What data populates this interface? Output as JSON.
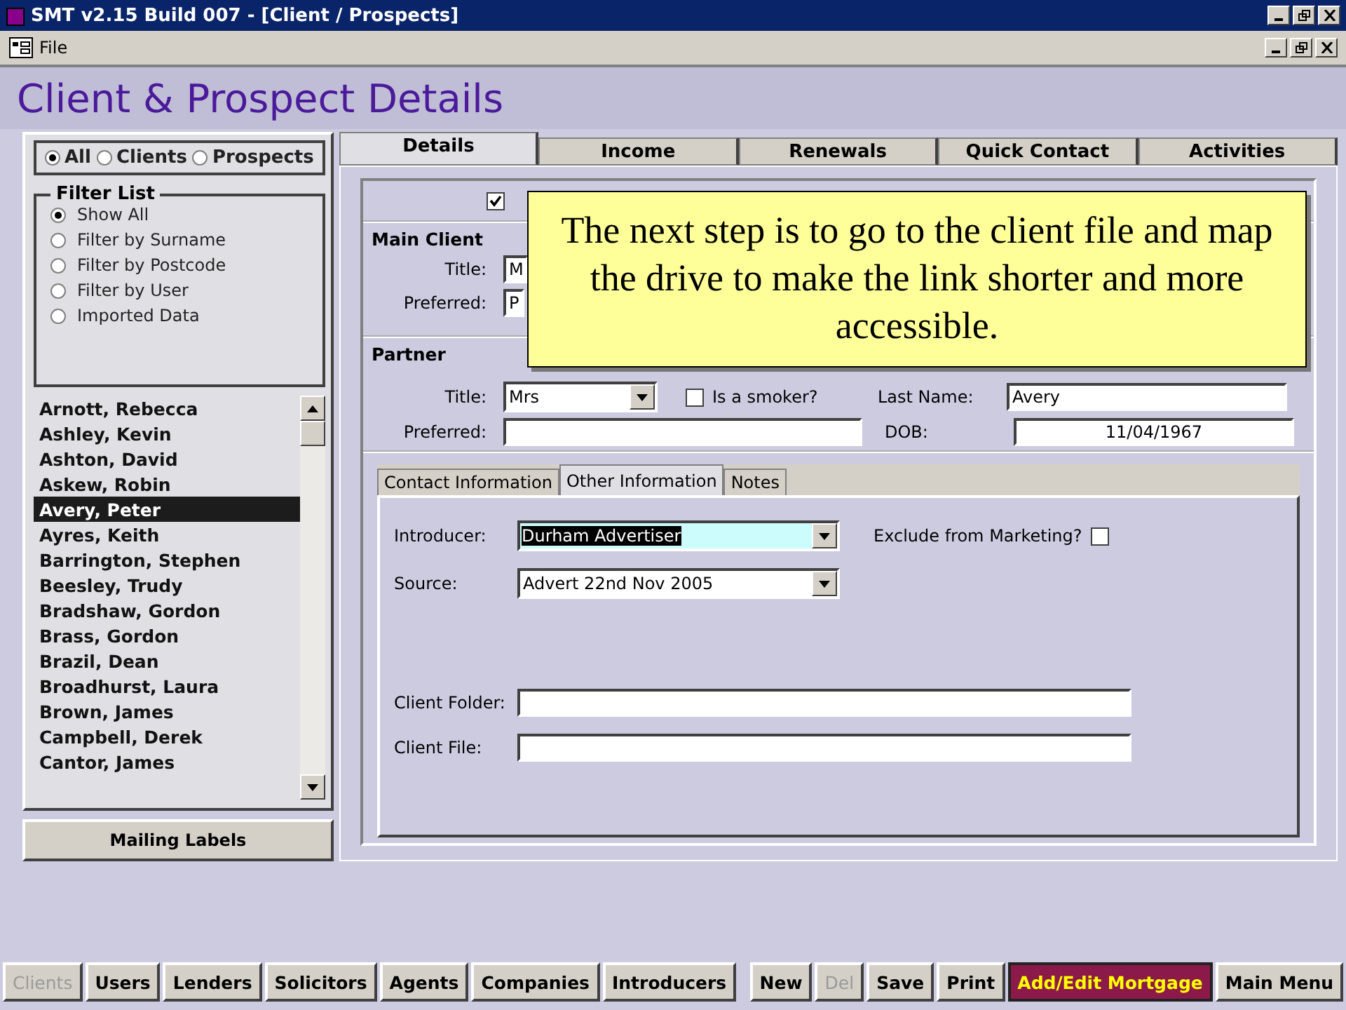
{
  "window": {
    "title": "SMT v2.15 Build 007 - [Client / Prospects]"
  },
  "menu_bar": {
    "items": [
      "File"
    ]
  },
  "header": {
    "title": "Client & Prospect Details"
  },
  "type_filter": [
    {
      "label": "All",
      "selected": true
    },
    {
      "label": "Clients",
      "selected": false
    },
    {
      "label": "Prospects",
      "selected": false
    }
  ],
  "filter_list": {
    "title": "Filter List",
    "options": [
      {
        "label": "Show All",
        "selected": true
      },
      {
        "label": "Filter by Surname",
        "selected": false
      },
      {
        "label": "Filter by Postcode",
        "selected": false
      },
      {
        "label": "Filter by User",
        "selected": false
      },
      {
        "label": "Imported Data",
        "selected": false
      }
    ]
  },
  "client_list": [
    {
      "name": "Arnott, Rebecca",
      "selected": false
    },
    {
      "name": "Ashley, Kevin",
      "selected": false
    },
    {
      "name": "Ashton, David",
      "selected": false
    },
    {
      "name": "Askew, Robin",
      "selected": false
    },
    {
      "name": "Avery, Peter",
      "selected": true
    },
    {
      "name": "Ayres, Keith",
      "selected": false
    },
    {
      "name": "Barrington, Stephen",
      "selected": false
    },
    {
      "name": "Beesley, Trudy",
      "selected": false
    },
    {
      "name": "Bradshaw, Gordon",
      "selected": false
    },
    {
      "name": "Brass, Gordon",
      "selected": false
    },
    {
      "name": "Brazil, Dean",
      "selected": false
    },
    {
      "name": "Broadhurst, Laura",
      "selected": false
    },
    {
      "name": "Brown, James",
      "selected": false
    },
    {
      "name": "Campbell, Derek",
      "selected": false
    },
    {
      "name": "Cantor, James",
      "selected": false
    }
  ],
  "mailing_labels_button": "Mailing Labels",
  "tabs": [
    {
      "label": "Details",
      "selected": true
    },
    {
      "label": "Income",
      "selected": false
    },
    {
      "label": "Renewals",
      "selected": false
    },
    {
      "label": "Quick Contact",
      "selected": false
    },
    {
      "label": "Activities",
      "selected": false
    }
  ],
  "details": {
    "top_checkbox": {
      "checked": true
    },
    "main_client": {
      "heading": "Main Client",
      "title_label": "Title:",
      "title_value": "M",
      "preferred_label": "Preferred:",
      "preferred_value": "P"
    },
    "partner": {
      "heading": "Partner",
      "title_label": "Title:",
      "title_value": "Mrs",
      "smoker_checked": false,
      "smoker_label": "Is a smoker?",
      "last_name_label": "Last Name:",
      "last_name_value": "Avery",
      "preferred_label": "Preferred:",
      "dob_label": "DOB:",
      "dob_value": "11/04/1967"
    }
  },
  "sub_tabs": [
    {
      "label": "Contact Information",
      "selected": false
    },
    {
      "label": "Other Information",
      "selected": true
    },
    {
      "label": "Notes",
      "selected": false
    }
  ],
  "other_information": {
    "introducer_label": "Introducer:",
    "introducer_value": "Durham Advertiser",
    "exclude_label": "Exclude from Marketing?",
    "exclude_checked": false,
    "source_label": "Source:",
    "source_value": "Advert 22nd Nov 2005",
    "client_folder_label": "Client Folder:",
    "client_file_label": "Client File:"
  },
  "callout": "The next step is to go to the client file and map the drive to make the link shorter and more accessible.",
  "bottom_buttons": [
    {
      "label": "Clients",
      "kind": "nav",
      "disabled": true
    },
    {
      "label": "Users",
      "kind": "nav",
      "disabled": false
    },
    {
      "label": "Lenders",
      "kind": "nav",
      "disabled": false
    },
    {
      "label": "Solicitors",
      "kind": "nav",
      "disabled": false
    },
    {
      "label": "Agents",
      "kind": "nav",
      "disabled": false
    },
    {
      "label": "Companies",
      "kind": "nav",
      "disabled": false
    },
    {
      "label": "Introducers",
      "kind": "nav",
      "disabled": false
    },
    {
      "label": "New",
      "kind": "action",
      "disabled": false
    },
    {
      "label": "Del",
      "kind": "action",
      "disabled": true
    },
    {
      "label": "Save",
      "kind": "action",
      "disabled": false
    },
    {
      "label": "Print",
      "kind": "action",
      "disabled": false
    },
    {
      "label": "Add/Edit Mortgage",
      "kind": "highlight",
      "disabled": false
    },
    {
      "label": "Main Menu",
      "kind": "action",
      "disabled": false
    }
  ]
}
